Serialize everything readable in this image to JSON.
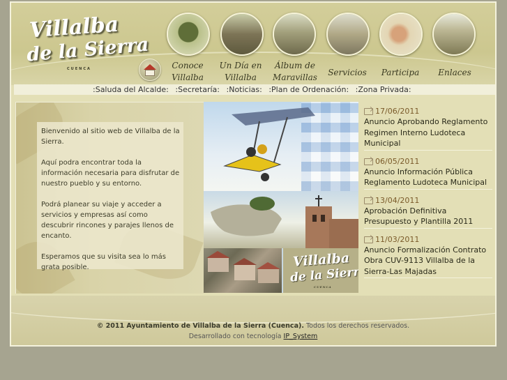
{
  "logo": {
    "line1": "Villalba",
    "line2": "de la Sierra",
    "line3": "CUENCA"
  },
  "nav": {
    "items": [
      {
        "line1": "Conoce",
        "line2": "Villalba",
        "icon": "tree-photo"
      },
      {
        "line1": "Un Día en",
        "line2": "Villalba",
        "icon": "hikers-photo"
      },
      {
        "line1": "Álbum de",
        "line2": "Maravillas",
        "icon": "landscape-photo"
      },
      {
        "line1": "Servicios",
        "line2": "",
        "icon": "building-photo"
      },
      {
        "line1": "Participa",
        "line2": "",
        "icon": "hand-photo"
      },
      {
        "line1": "Enlaces",
        "line2": "",
        "icon": "field-photo"
      }
    ],
    "home_icon": "house-icon"
  },
  "menu": {
    "items": [
      ":Saluda del Alcalde:",
      ":Secretaría:",
      ":Noticias:",
      ":Plan de Ordenación:",
      ":Zona Privada:"
    ]
  },
  "welcome": {
    "p1": "Bienvenido al sitio web de Villalba de la Sierra.",
    "p2": "Aquí podra encontrar toda la información necesaria para disfrutar de nuestro pueblo y su entorno.",
    "p3": "Podrá planear su viaje y acceder a servicios y empresas así como descubrir rincones y parajes llenos de encanto.",
    "p4": "Esperamos que su visita sea lo más grata posible."
  },
  "photos": {
    "logo_line1": "Villalba",
    "logo_line2": "de la Sierra",
    "logo_line3": "CUENCA"
  },
  "news": [
    {
      "date": "17/06/2011",
      "title": "Anuncio Aprobando Reglamento Regimen Interno Ludoteca Municipal"
    },
    {
      "date": "06/05/2011",
      "title": "Anuncio Información Pública Reglamento Ludoteca Municipal"
    },
    {
      "date": "13/04/2011",
      "title": "Aprobación Definitiva Presupuesto y Plantilla 2011"
    },
    {
      "date": "11/03/2011",
      "title": "Anuncio Formalización Contrato Obra CUV-9113 Villalba de la Sierra-Las Majadas"
    }
  ],
  "footer": {
    "copyright": "© 2011 Ayuntamiento de Villalba de la Sierra (Cuenca).",
    "rights": "Todos los derechos reservados.",
    "developed": "Desarrollado con tecnología",
    "link": "IP_System"
  },
  "colors": {
    "background": "#a6a490",
    "panel": "#e3dfb6",
    "menubar": "#f1efda",
    "date": "#7a5a2a"
  }
}
